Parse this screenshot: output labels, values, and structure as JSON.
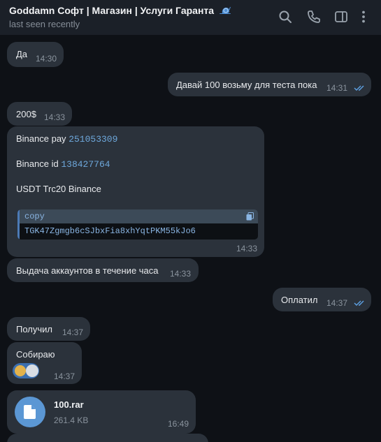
{
  "header": {
    "title": "Goddamn Софт | Магазин | Услуги Гаранта",
    "status": "last seen recently"
  },
  "colors": {
    "background": "#0e1116",
    "header": "#1b2028",
    "bubble": "#2b323b",
    "link": "#6ea8dc",
    "read_check": "#5ea2e6",
    "file_icon": "#5b97d4"
  },
  "messages": {
    "m1": {
      "text": "Да",
      "time": "14:30"
    },
    "m2": {
      "text": "Давай 100 возьму для теста пока",
      "time": "14:31"
    },
    "m3": {
      "text": "200$",
      "time": "14:33"
    },
    "m4": {
      "pay_label": "Binance pay",
      "pay_value": "251053309",
      "id_label": "Binance id",
      "id_value": "138427764",
      "network": "USDT Trc20 Binance",
      "code_lang": "copy",
      "code_value": "TGK47Zgmgb6cSJbxFia8xhYqtPKM55kJo6",
      "time": "14:33"
    },
    "m5": {
      "text": "Выдача аккаунтов в течение часа",
      "time": "14:33"
    },
    "m6": {
      "text": "Оплатил",
      "time": "14:37"
    },
    "m7": {
      "text": "Получил",
      "time": "14:37"
    },
    "m8": {
      "text": "Собираю",
      "time": "14:37",
      "reaction": "handshake-emoji"
    },
    "m9": {
      "file_name": "100.rar",
      "file_size": "261.4 KB",
      "time": "16:49"
    }
  }
}
